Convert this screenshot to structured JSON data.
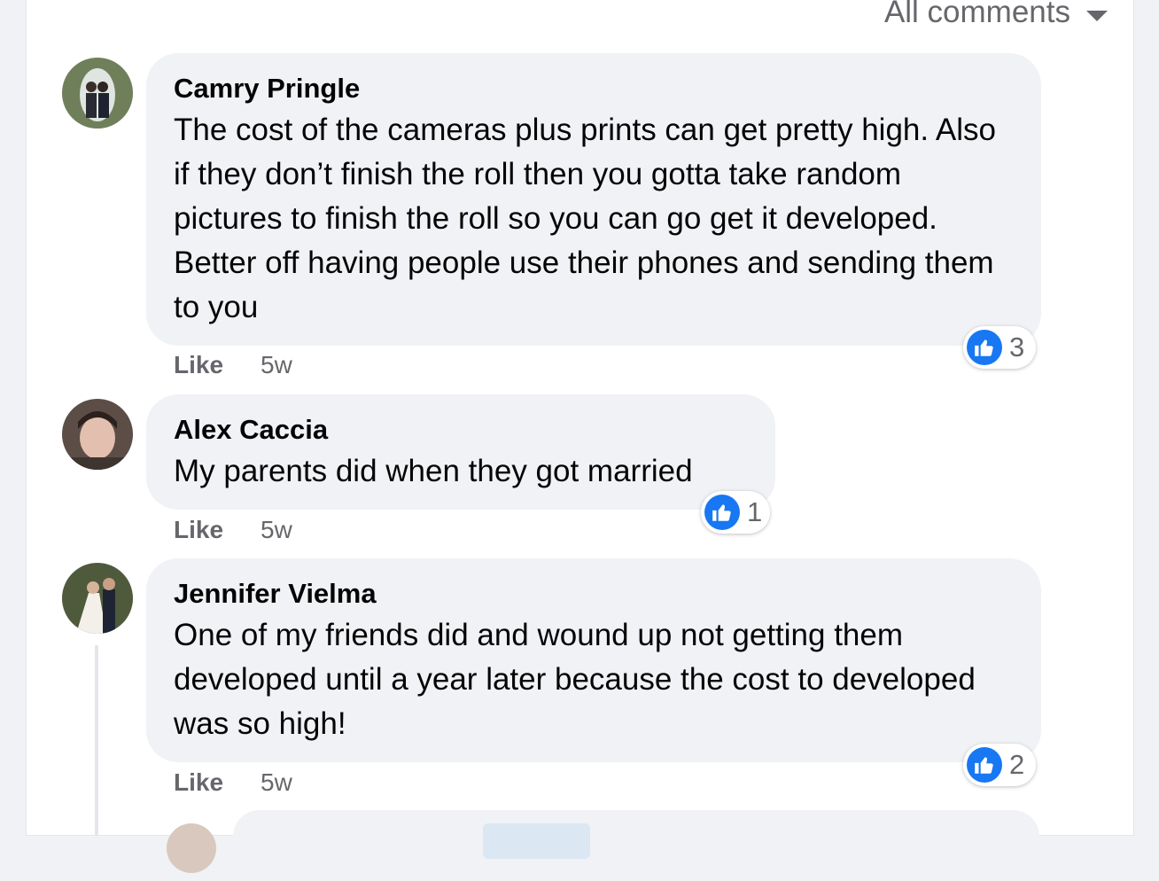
{
  "header": {
    "filter_label": "All comments",
    "filter_icon": "caret-down-icon"
  },
  "comments": [
    {
      "author": "Camry Pringle",
      "text": "The cost of the cameras plus prints can get pretty high. Also if they don’t finish the roll then you gotta take random pictures to finish the roll so you can go get it developed. Better off having people use their phones and sending them to you",
      "like_label": "Like",
      "time": "5w",
      "reaction_count": "3",
      "reaction_icon": "thumbs-up-icon"
    },
    {
      "author": "Alex Caccia",
      "text": "My parents did when they got married",
      "like_label": "Like",
      "time": "5w",
      "reaction_count": "1",
      "reaction_icon": "thumbs-up-icon"
    },
    {
      "author": "Jennifer Vielma",
      "text": "One of my friends did and wound up not getting them developed until a year later because the cost to developed was so high!",
      "like_label": "Like",
      "time": "5w",
      "reaction_count": "2",
      "reaction_icon": "thumbs-up-icon"
    }
  ],
  "colors": {
    "accent": "#1877f2",
    "bubble": "#f0f2f5",
    "secondary_text": "#65676b"
  }
}
